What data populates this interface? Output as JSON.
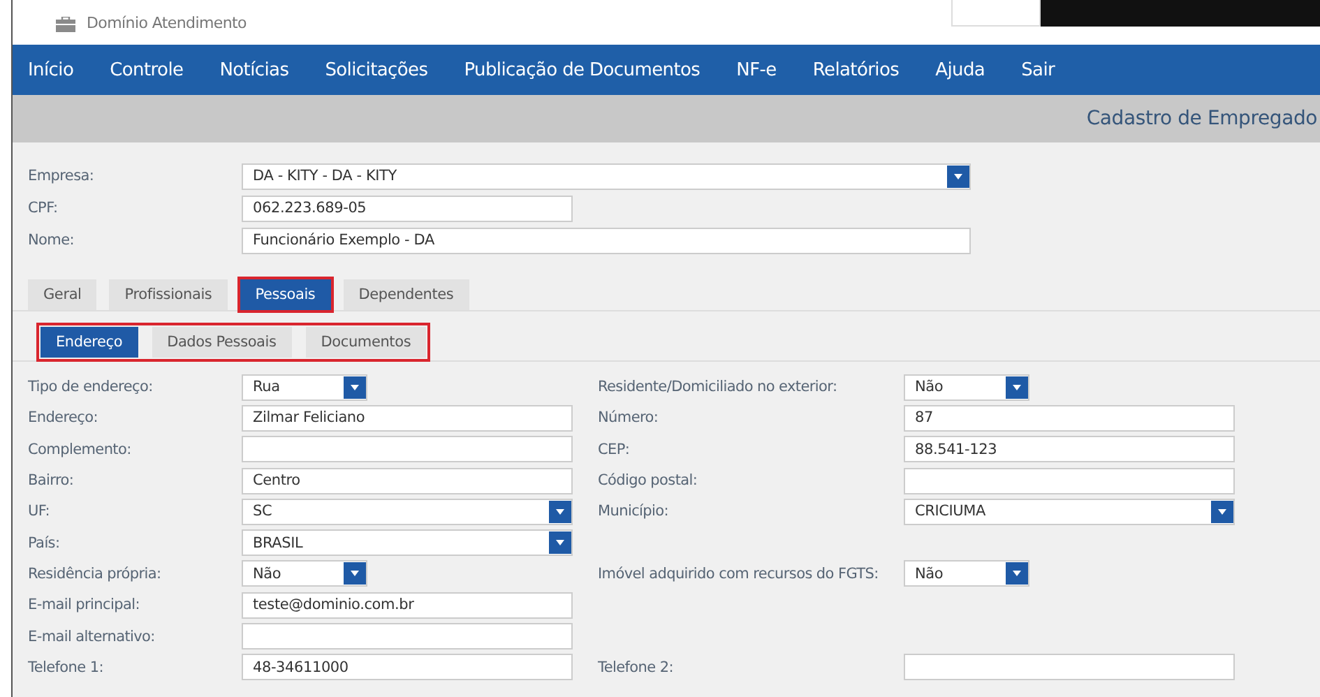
{
  "header": {
    "title": "Domínio Atendimento"
  },
  "nav": [
    "Início",
    "Controle",
    "Notícias",
    "Solicitações",
    "Publicação de Documentos",
    "NF-e",
    "Relatórios",
    "Ajuda",
    "Sair"
  ],
  "page_title": "Cadastro de Empregado",
  "top_fields": [
    {
      "label": "Empresa:",
      "value": "DA - KITY - DA - KITY",
      "kind": "select"
    },
    {
      "label": "CPF:",
      "value": "062.223.689-05",
      "kind": "short_text"
    },
    {
      "label": "Nome:",
      "value": "Funcionário Exemplo - DA",
      "kind": "text"
    }
  ],
  "tabs": [
    {
      "label": "Geral",
      "selected": false,
      "highlighted": false
    },
    {
      "label": "Profissionais",
      "selected": false,
      "highlighted": false
    },
    {
      "label": "Pessoais",
      "selected": true,
      "highlighted": true
    },
    {
      "label": "Dependentes",
      "selected": false,
      "highlighted": false
    }
  ],
  "subtabs": {
    "highlighted": true,
    "items": [
      {
        "label": "Endereço",
        "selected": true
      },
      {
        "label": "Dados Pessoais",
        "selected": false
      },
      {
        "label": "Documentos",
        "selected": false
      }
    ]
  },
  "rows": [
    {
      "left": {
        "label": "Tipo de endereço:",
        "value": "Rua",
        "kind": "short_select"
      },
      "right": {
        "label": "Residente/Domiciliado no exterior:",
        "value": "Não",
        "kind": "short_select"
      }
    },
    {
      "left": {
        "label": "Endereço:",
        "value": "Zilmar Feliciano",
        "kind": "text"
      },
      "right": {
        "label": "Número:",
        "value": "87",
        "kind": "text"
      }
    },
    {
      "left": {
        "label": "Complemento:",
        "kind": "text"
      },
      "right": {
        "label": "CEP:",
        "value": "88.541-123",
        "kind": "text"
      }
    },
    {
      "left": {
        "label": "Bairro:",
        "value": "Centro",
        "kind": "text"
      },
      "right": {
        "label": "Código postal:",
        "kind": "text"
      }
    },
    {
      "left": {
        "label": "UF:",
        "value": "SC",
        "kind": "select"
      },
      "right": {
        "label": "Município:",
        "value": "CRICIUMA",
        "kind": "select"
      }
    },
    {
      "left": {
        "label": "País:",
        "value": "BRASIL",
        "kind": "select"
      }
    },
    {
      "left": {
        "label": "Residência própria:",
        "value": "Não",
        "kind": "short_select"
      },
      "right": {
        "label": "Imóvel adquirido com recursos do FGTS:",
        "value": "Não",
        "kind": "short_select"
      }
    },
    {
      "left": {
        "label": "E-mail principal:",
        "value": "teste@dominio.com.br",
        "kind": "text"
      }
    },
    {
      "left": {
        "label": "E-mail alternativo:",
        "kind": "text"
      }
    },
    {
      "left": {
        "label": "Telefone 1:",
        "value": "48-34611000",
        "kind": "text"
      },
      "right": {
        "label": "Telefone 2:",
        "kind": "text"
      }
    }
  ]
}
